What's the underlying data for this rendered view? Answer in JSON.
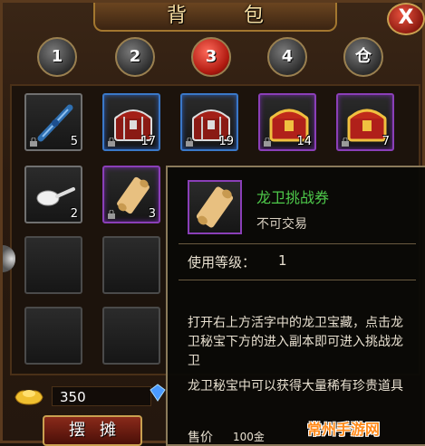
{
  "window": {
    "title": "背 包",
    "close_label": "X"
  },
  "tabs": [
    {
      "label": "1",
      "active": false
    },
    {
      "label": "2",
      "active": false
    },
    {
      "label": "3",
      "active": true
    },
    {
      "label": "4",
      "active": false
    },
    {
      "label": "仓",
      "active": false
    }
  ],
  "slots": [
    {
      "item": "scroll-blue",
      "qty": "5",
      "rarity": "gray"
    },
    {
      "item": "treasure-chest-red",
      "qty": "17",
      "rarity": "blue"
    },
    {
      "item": "treasure-chest-red",
      "qty": "19",
      "rarity": "blue"
    },
    {
      "item": "treasure-chest-gold",
      "qty": "14",
      "rarity": "purple"
    },
    {
      "item": "treasure-chest-gold",
      "qty": "7",
      "rarity": "purple"
    },
    {
      "item": "white-spoon",
      "qty": "2",
      "rarity": "gray"
    },
    {
      "item": "parchment-scroll",
      "qty": "3",
      "rarity": "purple"
    }
  ],
  "tooltip": {
    "name": "龙卫挑战券",
    "trade": "不可交易",
    "level_label": "使用等级：",
    "level_value": "1",
    "description": "打开右上方活字中的龙卫宝藏，点击龙卫秘宝下方的进入副本即可进入挑战龙卫",
    "description2": "龙卫秘宝中可以获得大量稀有珍贵道具",
    "price_label": "售价",
    "price_value": "100金"
  },
  "currency": {
    "gold": "350"
  },
  "buttons": {
    "stall": "摆摊"
  },
  "watermark": {
    "text": "常州手游网"
  },
  "colors": {
    "tooltip_name": "#4ec94a",
    "active_tab": "#b01a10"
  }
}
